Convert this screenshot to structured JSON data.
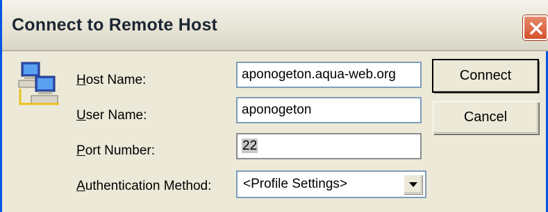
{
  "window": {
    "title": "Connect to Remote Host",
    "close_label": "Close"
  },
  "form": {
    "host_label_key": "H",
    "host_label_rest": "ost Name:",
    "host_value": "aponogeton.aqua-web.org",
    "user_label_key": "U",
    "user_label_rest": "ser Name:",
    "user_value": "aponogeton",
    "port_label_key": "P",
    "port_label_rest": "ort Number:",
    "port_value": "22",
    "auth_label_key": "A",
    "auth_label_rest": "uthentication Method:",
    "auth_value": "<Profile Settings>"
  },
  "buttons": {
    "connect": "Connect",
    "cancel": "Cancel"
  },
  "icons": {
    "dialog": "networked-computers-icon",
    "close": "close-icon",
    "dropdown": "chevron-down-icon"
  },
  "colors": {
    "title_bar_bg": "#ece9d8",
    "close_button": "#d4512a",
    "window_border": "#0055e5"
  }
}
